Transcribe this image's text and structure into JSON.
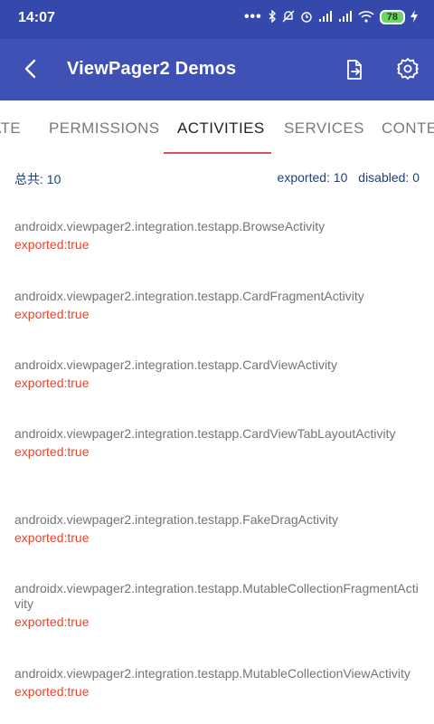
{
  "status_bar": {
    "time": "14:07",
    "dots": "•••",
    "battery": "78"
  },
  "app_bar": {
    "title": "ViewPager2 Demos"
  },
  "tabs": [
    {
      "label": "ATE"
    },
    {
      "label": "PERMISSIONS"
    },
    {
      "label": "ACTIVITIES"
    },
    {
      "label": "SERVICES"
    },
    {
      "label": "CONTE"
    }
  ],
  "summary": {
    "total": "总共: 10",
    "exported": "exported: 10",
    "disabled": "disabled: 0"
  },
  "activities": [
    {
      "name": "androidx.viewpager2.integration.testapp.BrowseActivity",
      "exported": "exported:true"
    },
    {
      "name": "androidx.viewpager2.integration.testapp.CardFragmentActivity",
      "exported": "exported:true"
    },
    {
      "name": "androidx.viewpager2.integration.testapp.CardViewActivity",
      "exported": "exported:true"
    },
    {
      "name": "androidx.viewpager2.integration.testapp.CardViewTabLayoutActivity",
      "exported": "exported:true"
    },
    {
      "name": "androidx.viewpager2.integration.testapp.FakeDragActivity",
      "exported": "exported:true"
    },
    {
      "name": "androidx.viewpager2.integration.testapp.MutableCollectionFragmentActivity",
      "exported": "exported:true"
    },
    {
      "name": "androidx.viewpager2.integration.testapp.MutableCollectionViewActivity",
      "exported": "exported:true"
    }
  ]
}
